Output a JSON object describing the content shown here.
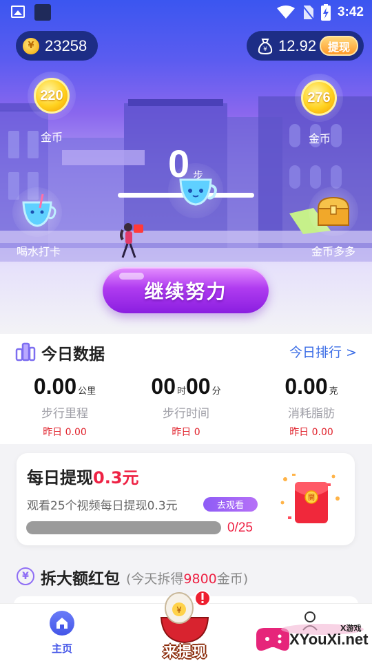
{
  "status_bar": {
    "time": "3:42"
  },
  "wallet": {
    "coins": "23258",
    "cash": "12.92",
    "withdraw_label": "提现",
    "coin_symbol": "¥"
  },
  "bubbles": [
    {
      "value": "220",
      "label": "金币"
    },
    {
      "value": "276",
      "label": "金币"
    }
  ],
  "steps": {
    "count": "0",
    "unit": "步"
  },
  "side_actions": {
    "drink_label": "喝水打卡",
    "chest_label": "金币多多"
  },
  "cta_label": "继续努力",
  "today": {
    "title": "今日数据",
    "rank_link": "今日排行 >",
    "stats": [
      {
        "value": "0.00",
        "unit": "公里",
        "label": "步行里程",
        "yesterday": "昨日 0.00"
      },
      {
        "value": "00",
        "unit": "时",
        "value2": "00",
        "unit2": "分",
        "label": "步行时间",
        "yesterday": "昨日 0"
      },
      {
        "value": "0.00",
        "unit": "克",
        "label": "消耗脂肪",
        "yesterday": "昨日 0.00"
      }
    ]
  },
  "daily_withdraw": {
    "title_prefix": "每日提现",
    "title_amount": "0.3元",
    "subtitle": "观看25个视频每日提现0.3元",
    "watch_label": "去观看",
    "progress_text": "0/25",
    "progress_fraction": 0,
    "packet_char": "開"
  },
  "big_packet": {
    "icon_char": "¥",
    "title": "拆大额红包",
    "sub_prefix": "(今天拆得",
    "sub_amount": "9800",
    "sub_suffix": "金币)"
  },
  "nav": {
    "home_label": "主页",
    "center_label": "来提现"
  },
  "watermark": {
    "small": "X游戏",
    "main": "XYouXi.net"
  },
  "colors": {
    "accent": "#4456e8",
    "red": "#ee2244",
    "purple": "#8a1ee0"
  }
}
